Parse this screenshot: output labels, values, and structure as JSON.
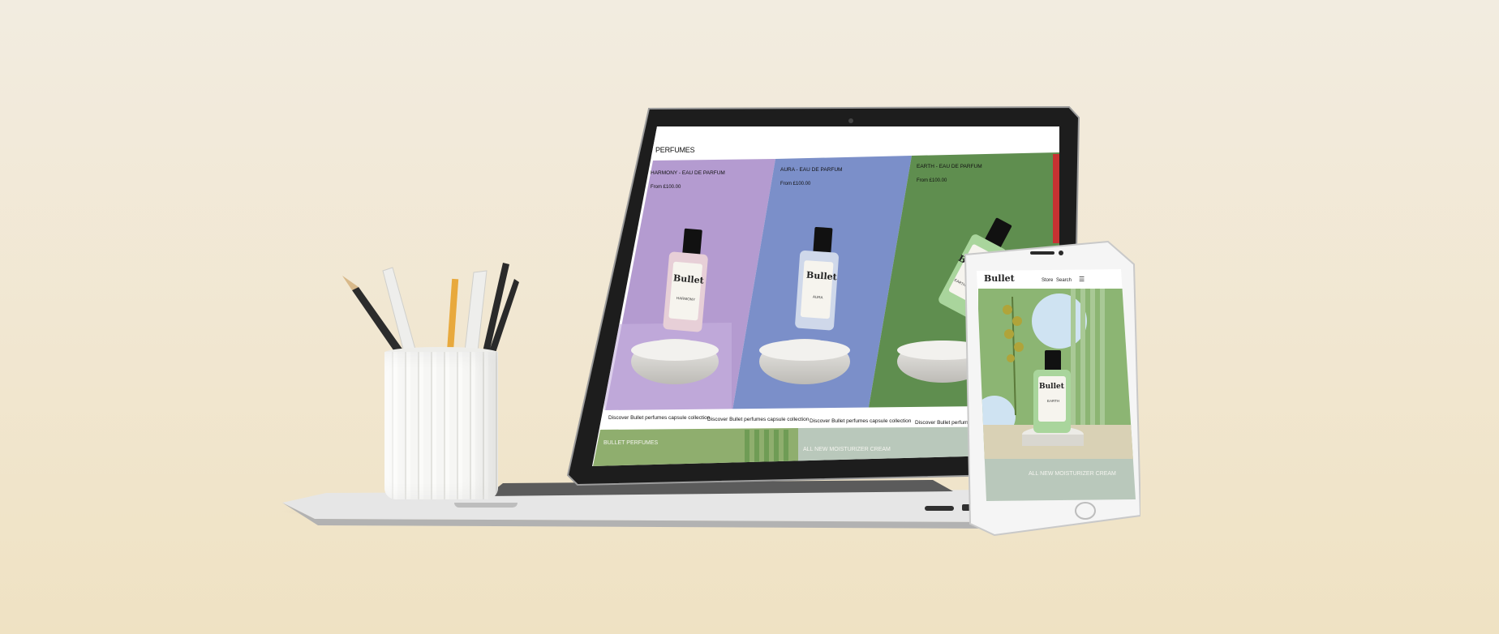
{
  "scene": {
    "background_color": "#f1e8d3"
  },
  "laptop_site": {
    "nav_title": "PERFUMES",
    "products": [
      {
        "name": "HARMONY - EAU DE PARFUM",
        "price": "From £100.00",
        "bottle_label": "Bullet",
        "bottle_sub": "HARMONY",
        "panel_color": "#b49bd0"
      },
      {
        "name": "AURA - EAU DE PARFUM",
        "price": "From £100.00",
        "bottle_label": "Bullet",
        "bottle_sub": "AURA",
        "panel_color": "#7b8fc9"
      },
      {
        "name": "EARTH - EAU DE PARFUM",
        "price": "From £100.00",
        "bottle_label": "Bullet",
        "bottle_sub": "EARTH",
        "panel_color": "#5f8e4f"
      }
    ],
    "marquee": [
      "Discover Bullet perfumes capsule collection",
      "Discover Bullet perfumes capsule collection",
      "Discover Bullet perfumes capsule collection",
      "Discover Bullet perfumes capsule collection"
    ],
    "banners": [
      {
        "label": "BULLET PERFUMES",
        "color": "#8fae6e"
      },
      {
        "label": "ALL NEW MOISTURIZER CREAM",
        "color": "#b9c8bb"
      }
    ]
  },
  "phone_site": {
    "logo": "Bullet",
    "nav_links": [
      "Store",
      "Search"
    ],
    "bottle_label": "Bullet",
    "bottle_sub": "EARTH",
    "banner": "ALL NEW MOISTURIZER CREAM"
  }
}
